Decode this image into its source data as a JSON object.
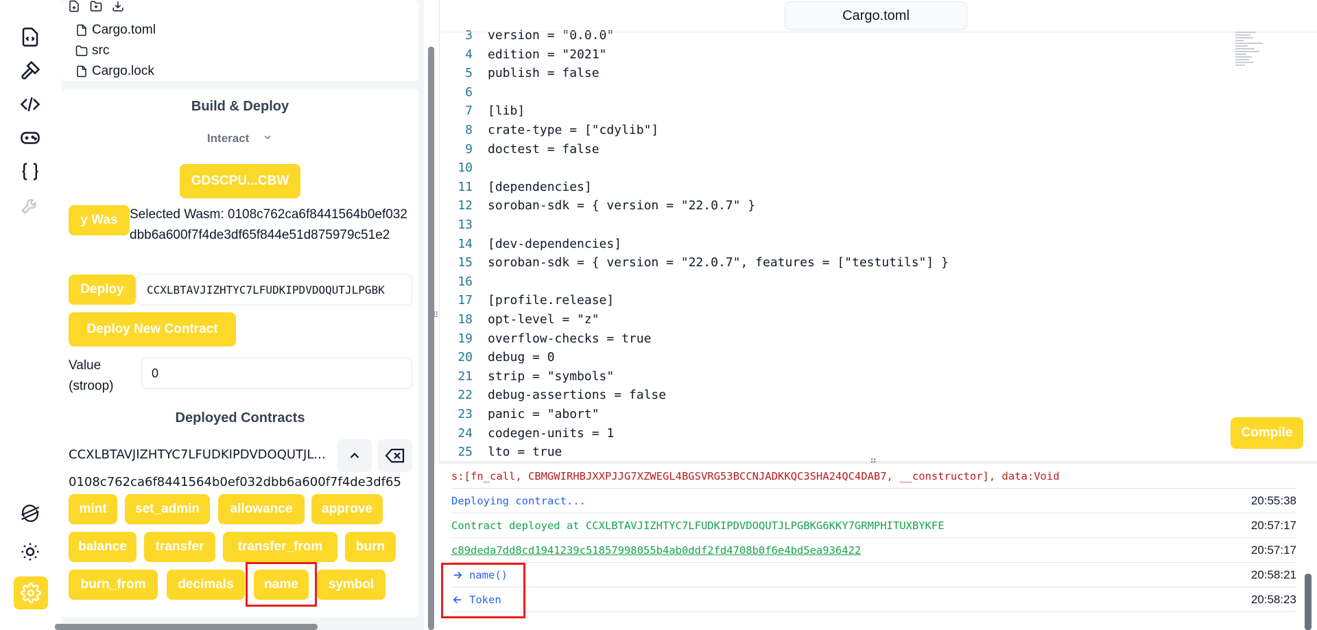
{
  "explorer": {
    "files": [
      {
        "name": "Cargo.toml",
        "kind": "file"
      },
      {
        "name": "src",
        "kind": "folder"
      },
      {
        "name": "Cargo.lock",
        "kind": "file"
      }
    ]
  },
  "deploy": {
    "title": "Build & Deploy",
    "mode": "Interact",
    "account_button": "GDSCPU...CBW",
    "wasm_button": "y Was",
    "selected_wasm": "Selected Wasm: 0108c762ca6f8441564b0ef032dbb6a600f7f4de3df65f844e51d875979c51e2",
    "deploy_button": "Deploy",
    "contract_address_value": "CCXLBTAVJIZHTYC7LFUDKIPDVDOQUTJLPGBK",
    "deploy_new_button": "Deploy New Contract",
    "value_label": "Value (stroop)",
    "value_input": "0",
    "deployed_title": "Deployed Contracts",
    "deployed_contract": "CCXLBTAVJIZHTYC7LFUDKIPDVDOQUTJL...",
    "deployed_hash": "0108c762ca6f8441564b0ef032dbb6a600f7f4de3df65",
    "functions": [
      "mint",
      "set_admin",
      "allowance",
      "approve",
      "balance",
      "transfer",
      "transfer_from",
      "burn",
      "burn_from",
      "decimals",
      "name",
      "symbol"
    ]
  },
  "editor": {
    "tab_label": "Cargo.toml",
    "lines": [
      {
        "n": "3",
        "text": "version = \"0.0.0\""
      },
      {
        "n": "4",
        "text": "edition = \"2021\""
      },
      {
        "n": "5",
        "text": "publish = false"
      },
      {
        "n": "6",
        "text": ""
      },
      {
        "n": "7",
        "text": "[lib]"
      },
      {
        "n": "8",
        "text": "crate-type = [\"cdylib\"]"
      },
      {
        "n": "9",
        "text": "doctest = false"
      },
      {
        "n": "10",
        "text": ""
      },
      {
        "n": "11",
        "text": "[dependencies]"
      },
      {
        "n": "12",
        "text": "soroban-sdk = { version = \"22.0.7\" }"
      },
      {
        "n": "13",
        "text": ""
      },
      {
        "n": "14",
        "text": "[dev-dependencies]"
      },
      {
        "n": "15",
        "text": "soroban-sdk = { version = \"22.0.7\", features = [\"testutils\"] }"
      },
      {
        "n": "16",
        "text": ""
      },
      {
        "n": "17",
        "text": "[profile.release]"
      },
      {
        "n": "18",
        "text": "opt-level = \"z\""
      },
      {
        "n": "19",
        "text": "overflow-checks = true"
      },
      {
        "n": "20",
        "text": "debug = 0"
      },
      {
        "n": "21",
        "text": "strip = \"symbols\""
      },
      {
        "n": "22",
        "text": "debug-assertions = false"
      },
      {
        "n": "23",
        "text": "panic = \"abort\""
      },
      {
        "n": "24",
        "text": "codegen-units = 1"
      },
      {
        "n": "25",
        "text": "lto = true"
      }
    ],
    "compile_button": "Compile"
  },
  "console": {
    "logs": [
      {
        "msg": "s:[fn_call, CBMGWIRHBJXXPJJG7XZWEGL4BGSVRG53BCCNJADKKQC3SHA24QC4DAB7, __constructor], data:Void",
        "time": "",
        "style": "red",
        "arrow": ""
      },
      {
        "msg": "Deploying contract...",
        "time": "20:55:38",
        "style": "blue",
        "arrow": ""
      },
      {
        "msg": "Contract deployed at CCXLBTAVJIZHTYC7LFUDKIPDVDOQUTJLPGBKG6KKY7GRMPHITUXBYKFE",
        "time": "20:57:17",
        "style": "green",
        "arrow": ""
      },
      {
        "msg": "c89deda7dd8cd1941239c51857998055b4ab0ddf2fd4708b0f6e4bd5ea936422",
        "time": "20:57:17",
        "style": "link",
        "arrow": ""
      },
      {
        "msg": "name()",
        "time": "20:58:21",
        "style": "blue",
        "arrow": "out"
      },
      {
        "msg": "Token",
        "time": "20:58:23",
        "style": "blue",
        "arrow": "in"
      }
    ]
  },
  "colors": {
    "accent": "#fcd829",
    "highlight": "#ef1c1c"
  }
}
